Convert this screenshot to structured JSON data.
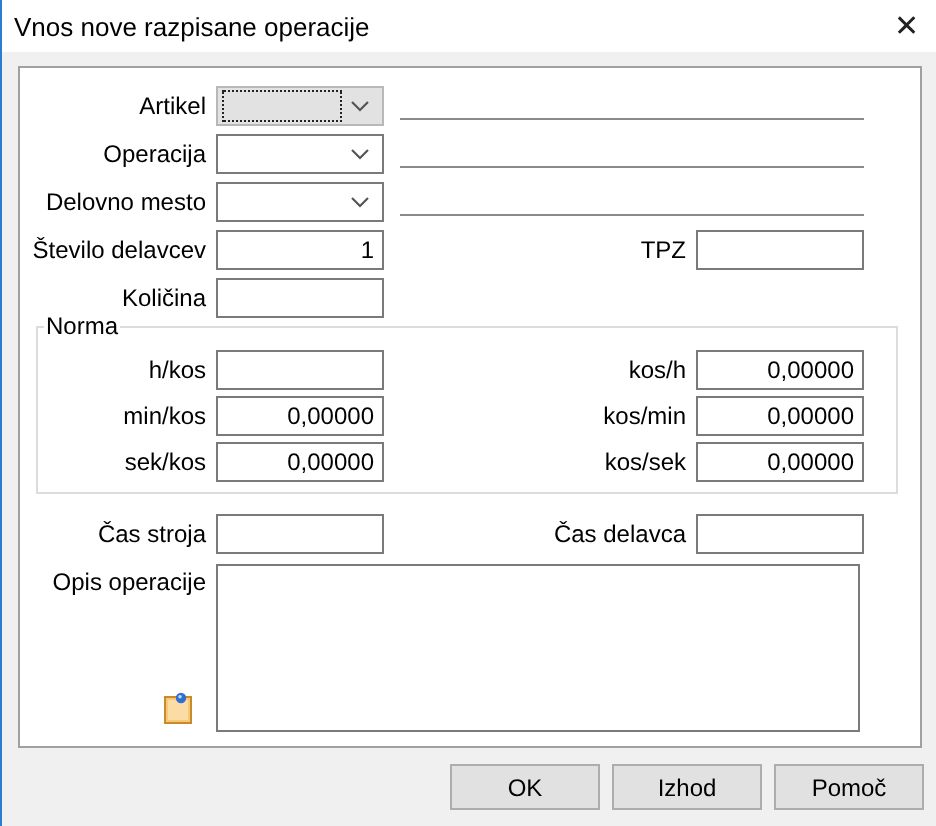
{
  "window": {
    "title": "Vnos nove razpisane operacije",
    "close": "✕"
  },
  "fields": [
    {
      "kind": "combo",
      "label": "Artikel",
      "disabled": true,
      "focused": true
    },
    {
      "kind": "combo",
      "label": "Operacija",
      "disabled": false,
      "focused": false
    },
    {
      "kind": "combo",
      "label": "Delovno mesto",
      "disabled": false,
      "focused": false
    },
    {
      "kind": "pair",
      "label": "Število delavcev",
      "value": "1",
      "right_label": "TPZ"
    },
    {
      "kind": "single",
      "label": "Količina"
    }
  ],
  "norma": {
    "title": "Norma",
    "rows": [
      {
        "label": "h/kos",
        "right_label": "kos/h",
        "right_value": "0,00000"
      },
      {
        "label": "min/kos",
        "value": "0,00000",
        "right_label": "kos/min",
        "right_value": "0,00000"
      },
      {
        "label": "sek/kos",
        "value": "0,00000",
        "right_label": "kos/sek",
        "right_value": "0,00000"
      }
    ]
  },
  "times": {
    "label": "Čas stroja",
    "right_label": "Čas delavca"
  },
  "description": {
    "label": "Opis operacije"
  },
  "buttons": [
    "OK",
    "Izhod",
    "Pomoč"
  ]
}
